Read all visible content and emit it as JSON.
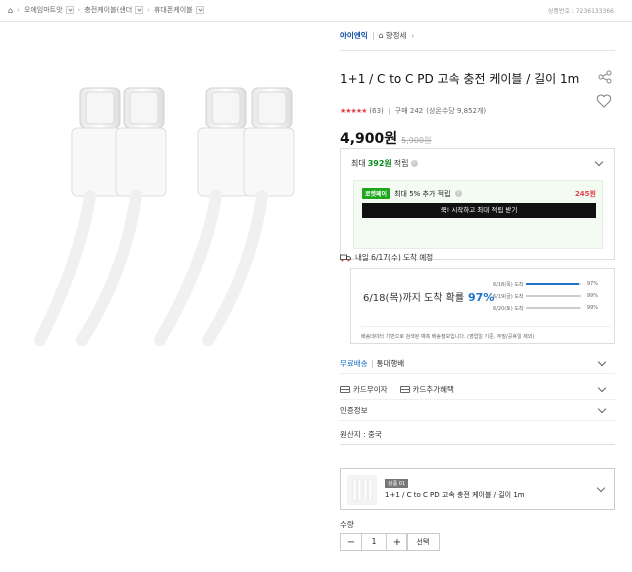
{
  "breadcrumb": {
    "home_icon": "home-icon",
    "items": [
      "오에임마트앗",
      "충전케이블(샌더",
      "휴대폰케이블"
    ],
    "product_number": "상품번호 : 7236133366"
  },
  "store": {
    "name": "아이엔익",
    "home_label": "향정세"
  },
  "product": {
    "title": "1+1 / C to C PD 고속 충전 케이블 / 길이 1m",
    "rating_count": "(63)",
    "purchase_label": "구매 242",
    "purchase_note": "(상온수당 9,852개)",
    "price": "4,900원",
    "old_price": "5,900원"
  },
  "benefit": {
    "prefix": "최대",
    "points": "392원",
    "suffix": "적립",
    "rocketpay_badge": "로켓페이",
    "rocketpay_text": "최대 5% 추가 적립",
    "rocketpay_amount": "245원",
    "rocketpay_cta": "쿡! 시작하고 최대 적립 받기"
  },
  "delivery": {
    "heading": "내일 6/17(수) 도착 예정",
    "arrival_prefix": "6/18(목)까지 도착 확률",
    "arrival_pct": "97%",
    "bars": [
      {
        "label": "6/18(목) 도착",
        "value": "97%",
        "fraction": 0.97,
        "color": "#1a73c9"
      },
      {
        "label": "6/19(금) 도착",
        "value": "99%",
        "fraction": 0.99,
        "color": "#cccccc"
      },
      {
        "label": "6/20(토) 도착",
        "value": "99%",
        "fraction": 0.99,
        "color": "#cccccc"
      }
    ],
    "note": "배송데이터 기반으로 검색된 예측 배송정보입니다. (영업일 기준, 주말/공휴일 제외)"
  },
  "rows": {
    "shipping_free": "무료배송",
    "shipping_detail": "통대행배",
    "card_free": "카드무이자",
    "card_discount": "카드추가혜택",
    "cert_info": "인증정보",
    "origin": "원산지 : 중국"
  },
  "option": {
    "badge": "상품 01",
    "name": "1+1 / C to C PD 고속 충전 케이블 / 길이 1m"
  },
  "quantity": {
    "label": "수량",
    "value": "1",
    "select_label": "선택"
  },
  "colors": {
    "accent_blue": "#1a73c9",
    "point_green": "#0a8a1f",
    "star_red": "#e2414a"
  }
}
